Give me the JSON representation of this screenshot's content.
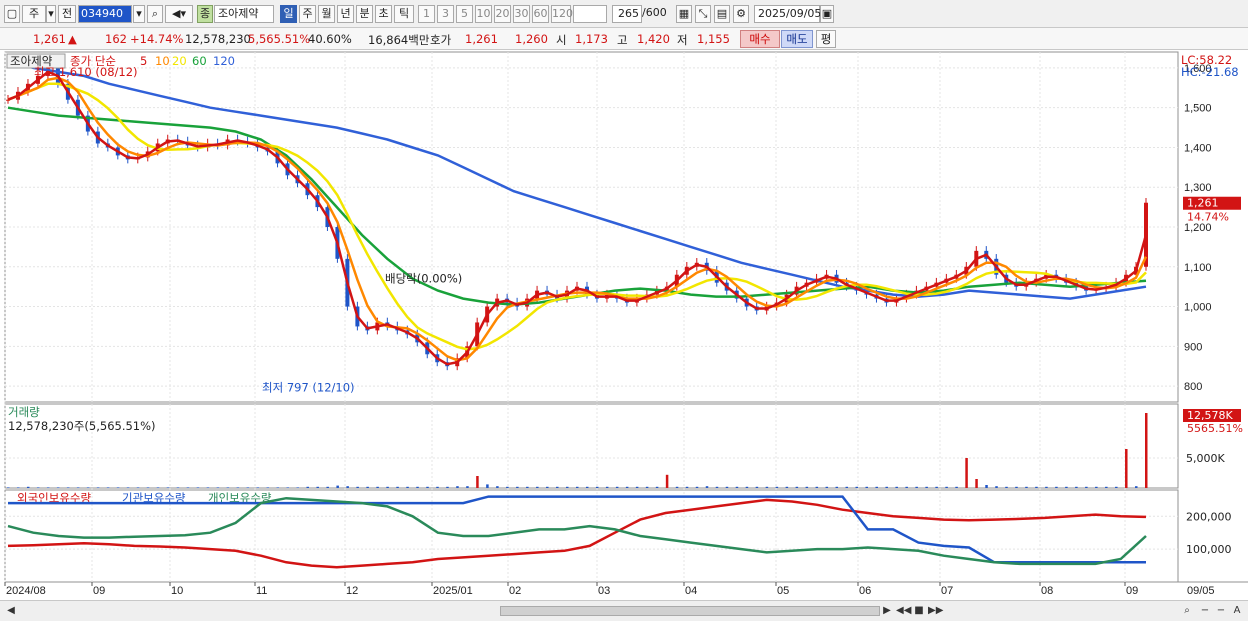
{
  "toolbar": {
    "icon_left": "window-icon",
    "type_select": "주",
    "prev_label": "전",
    "code": "034940",
    "stock_badge": "종",
    "stock_name": "조아제약",
    "periods": [
      "일",
      "주",
      "월",
      "년",
      "분",
      "초",
      "틱"
    ],
    "active_period": "일",
    "intervals": [
      "1",
      "3",
      "5",
      "10",
      "20",
      "30",
      "60",
      "120"
    ],
    "count": "265",
    "count_total": "/600",
    "date": "2025/09/05"
  },
  "quote": {
    "price": "1,261",
    "change_arrow": "▲",
    "change": "162",
    "change_pct": "+14.74%",
    "volume": "12,578,230",
    "vol_ratio": "5,565.51%",
    "turnover": "40.60%",
    "amount": "16,864백만",
    "bid_label": "호가",
    "ask": "1,261",
    "bid": "1,260",
    "open_label": "시",
    "open": "1,173",
    "high_label": "고",
    "high": "1,420",
    "low_label": "저",
    "low": "1,155",
    "buy_label": "매수",
    "sell_label": "매도",
    "eval_label": "평"
  },
  "chart_data": {
    "type": "line",
    "price_panel": {
      "title": "조아제약",
      "legend_label": "종가 단순",
      "ma_periods": [
        "5",
        "10",
        "20",
        "60",
        "120"
      ],
      "ma_colors": [
        "#d21414",
        "#ff8800",
        "#f2e600",
        "#19a23a",
        "#3060d8"
      ],
      "lc_label": "LC:58.22",
      "hc_label": "HC:-21.68",
      "y_ticks": [
        800,
        900,
        1000,
        1100,
        1200,
        1300,
        1400,
        1500,
        1600
      ],
      "y_tick_labels": [
        "800",
        "900",
        "1,000",
        "1,100",
        "1,200",
        "1,300",
        "1,400",
        "1,500",
        "1,600"
      ],
      "ylim": [
        760,
        1640
      ],
      "current_price_label": "1,261",
      "current_pct_label": "14.74%",
      "annotation_high": "최고 1,610 (08/12)",
      "annotation_low": "최저 797 (12/10)",
      "annotation_exdiv": "배당락(0.00%)",
      "close_series": [
        1520,
        1540,
        1560,
        1580,
        1600,
        1560,
        1520,
        1480,
        1440,
        1410,
        1400,
        1380,
        1370,
        1375,
        1390,
        1410,
        1420,
        1415,
        1405,
        1400,
        1410,
        1405,
        1420,
        1415,
        1410,
        1400,
        1390,
        1360,
        1330,
        1310,
        1280,
        1250,
        1200,
        1120,
        1000,
        950,
        940,
        960,
        950,
        940,
        930,
        910,
        880,
        860,
        850,
        870,
        900,
        960,
        1000,
        1020,
        1010,
        1000,
        1020,
        1040,
        1030,
        1020,
        1040,
        1050,
        1030,
        1020,
        1030,
        1020,
        1010,
        1020,
        1030,
        1040,
        1050,
        1080,
        1100,
        1110,
        1090,
        1060,
        1040,
        1020,
        1000,
        990,
        1000,
        1010,
        1030,
        1050,
        1060,
        1070,
        1080,
        1060,
        1050,
        1040,
        1030,
        1020,
        1010,
        1020,
        1030,
        1040,
        1050,
        1060,
        1070,
        1080,
        1100,
        1140,
        1120,
        1080,
        1060,
        1050,
        1060,
        1070,
        1080,
        1070,
        1060,
        1050,
        1040,
        1045,
        1050,
        1060,
        1080,
        1100,
        1261
      ],
      "ma120_series": [
        1620,
        1600,
        1590,
        1580,
        1560,
        1545,
        1530,
        1515,
        1500,
        1490,
        1480,
        1470,
        1460,
        1450,
        1435,
        1420,
        1400,
        1380,
        1350,
        1320,
        1290,
        1270,
        1250,
        1230,
        1210,
        1190,
        1170,
        1150,
        1130,
        1110,
        1095,
        1080,
        1065,
        1050,
        1040,
        1030,
        1025,
        1030,
        1040,
        1035,
        1030,
        1025,
        1020,
        1030,
        1040,
        1050
      ],
      "ma60_series": [
        1500,
        1490,
        1480,
        1475,
        1470,
        1465,
        1460,
        1455,
        1450,
        1440,
        1420,
        1380,
        1320,
        1250,
        1180,
        1120,
        1070,
        1040,
        1020,
        1010,
        1005,
        1010,
        1020,
        1030,
        1040,
        1045,
        1040,
        1030,
        1025,
        1025,
        1030,
        1035,
        1040,
        1045,
        1050,
        1040,
        1035,
        1040,
        1050,
        1055,
        1060,
        1055,
        1050,
        1055,
        1060,
        1065
      ]
    },
    "volume_panel": {
      "title": "거래량",
      "value_label": "12,578,230주(5,565.51%)",
      "y_tick_labels": [
        "5,000K"
      ],
      "current_label": "12,578K",
      "current_pct": "5565.51%",
      "values": [
        0.1,
        0.1,
        0.2,
        0.1,
        0.1,
        0.1,
        0.1,
        0.1,
        0.1,
        0.1,
        0.1,
        0.1,
        0.1,
        0.1,
        0.1,
        0.1,
        0.1,
        0.1,
        0.1,
        0.1,
        0.1,
        0.1,
        0.1,
        0.1,
        0.1,
        0.1,
        0.1,
        0.1,
        0.1,
        0.1,
        0.2,
        0.2,
        0.2,
        0.4,
        0.3,
        0.2,
        0.2,
        0.2,
        0.2,
        0.2,
        0.2,
        0.2,
        0.2,
        0.2,
        0.2,
        0.3,
        0.3,
        2.0,
        0.6,
        0.3,
        0.2,
        0.2,
        0.2,
        0.2,
        0.2,
        0.2,
        0.2,
        0.2,
        0.2,
        0.2,
        0.2,
        0.2,
        0.2,
        0.2,
        0.2,
        0.2,
        2.2,
        0.2,
        0.2,
        0.2,
        0.3,
        0.2,
        0.2,
        0.2,
        0.2,
        0.2,
        0.2,
        0.2,
        0.2,
        0.2,
        0.2,
        0.2,
        0.2,
        0.2,
        0.2,
        0.2,
        0.2,
        0.2,
        0.2,
        0.2,
        0.2,
        0.2,
        0.2,
        0.2,
        0.2,
        0.2,
        5.0,
        1.5,
        0.5,
        0.3,
        0.2,
        0.2,
        0.2,
        0.2,
        0.2,
        0.2,
        0.2,
        0.2,
        0.2,
        0.2,
        0.2,
        0.2,
        6.5,
        0.3,
        12.5
      ]
    },
    "holdings_panel": {
      "series_names": [
        "외국인보유수량",
        "기관보유수량",
        "개인보유수량"
      ],
      "series_colors": [
        "#d21414",
        "#1f55c8",
        "#2a8a5a"
      ],
      "y_tick_labels": [
        "200,000",
        "100,000"
      ],
      "foreign": [
        110,
        112,
        115,
        118,
        115,
        110,
        108,
        105,
        100,
        95,
        80,
        60,
        50,
        45,
        50,
        55,
        60,
        70,
        75,
        80,
        85,
        90,
        95,
        110,
        150,
        190,
        210,
        220,
        230,
        240,
        250,
        245,
        235,
        220,
        210,
        200,
        195,
        190,
        188,
        190,
        192,
        195,
        200,
        205,
        200,
        198
      ],
      "institution": [
        240,
        240,
        240,
        240,
        240,
        240,
        240,
        240,
        240,
        240,
        240,
        240,
        240,
        240,
        240,
        240,
        240,
        240,
        240,
        260,
        260,
        260,
        260,
        260,
        260,
        260,
        260,
        260,
        260,
        260,
        260,
        260,
        260,
        260,
        160,
        160,
        120,
        110,
        105,
        60,
        60,
        60,
        60,
        60,
        60,
        60
      ],
      "individual": [
        170,
        150,
        140,
        135,
        135,
        138,
        140,
        142,
        150,
        180,
        240,
        255,
        250,
        245,
        240,
        230,
        200,
        150,
        140,
        140,
        150,
        160,
        160,
        170,
        160,
        140,
        130,
        120,
        110,
        100,
        90,
        95,
        100,
        100,
        105,
        100,
        95,
        80,
        70,
        60,
        55,
        55,
        55,
        55,
        70,
        140
      ]
    },
    "x_tick_labels": [
      "2024/08",
      "09",
      "10",
      "11",
      "12",
      "2025/01",
      "02",
      "03",
      "04",
      "05",
      "06",
      "07",
      "08",
      "09",
      "09/05"
    ]
  }
}
